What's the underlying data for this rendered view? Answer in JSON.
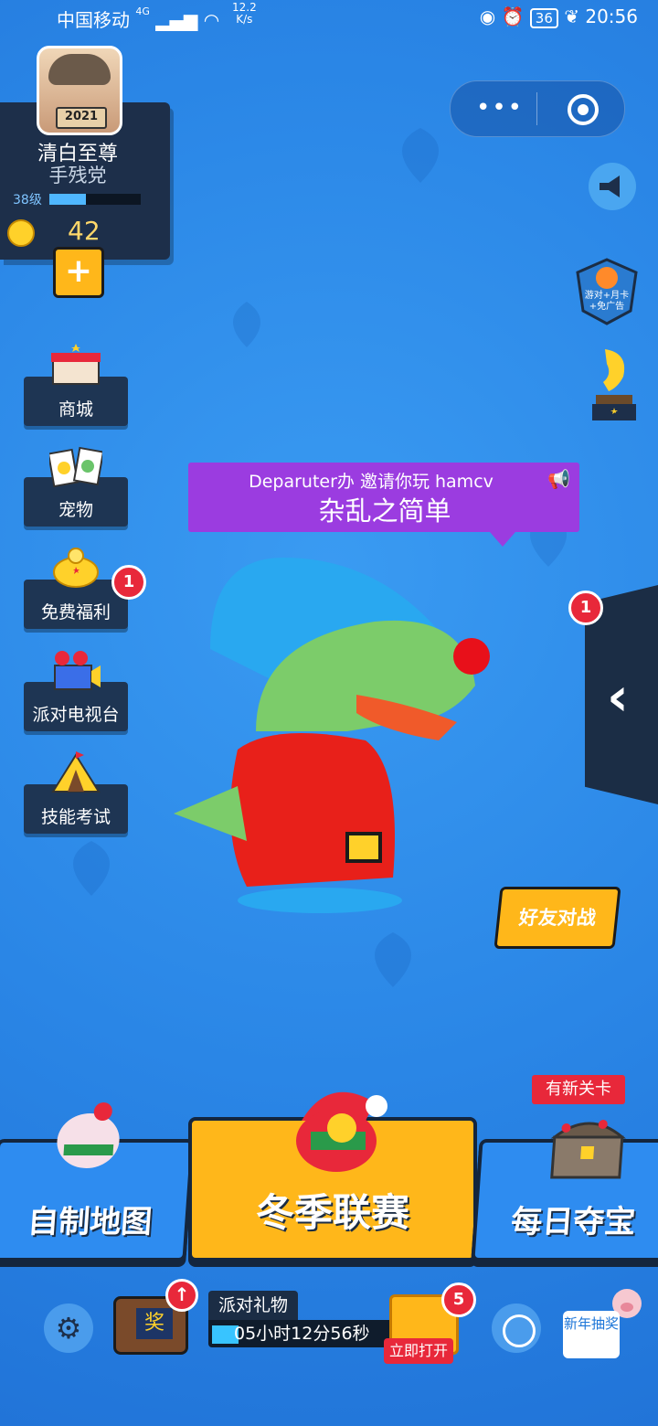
{
  "status_bar": {
    "carrier": "中国移动",
    "network": "4G",
    "speed_value": "12.2",
    "speed_unit": "K/s",
    "battery": "36",
    "time": "20:56"
  },
  "profile": {
    "avatar_tag": "2021",
    "name": "清白至尊",
    "title": "手残党",
    "level": "38级",
    "level_progress": 0.4,
    "coins": "42",
    "add_icon": "plus-icon"
  },
  "sidebar": {
    "items": [
      {
        "label": "商城",
        "icon": "shop-icon"
      },
      {
        "label": "宠物",
        "icon": "pet-cards-icon"
      },
      {
        "label": "免费福利",
        "icon": "piggy-bank-icon",
        "badge": "1"
      },
      {
        "label": "派对电视台",
        "icon": "tv-camera-icon"
      },
      {
        "label": "技能考试",
        "icon": "tent-icon"
      }
    ]
  },
  "right_panel": {
    "badge_text": "游对+月卡 +免广告",
    "drawer_badge": "1"
  },
  "invite": {
    "line1": "Deparuter办 邀请你玩 hamcv",
    "line2": "杂乱之简单"
  },
  "buttons": {
    "friend_battle": "好友对战",
    "custom_map": "自制地图",
    "winter_league": "冬季联赛",
    "daily_treasure": "每日夺宝",
    "new_level_tag": "有新关卡"
  },
  "bottom": {
    "tv_label": "奖",
    "party_gift_title": "派对礼物",
    "party_gift_time": "05小时12分56秒",
    "gift_progress": 0.14,
    "chest_badge": "5",
    "open_now": "立即打开",
    "new_year_draw": "新年抽奖"
  },
  "colors": {
    "background": "#2b8ae8",
    "accent": "#ffb71a",
    "panel": "#1d2f4a",
    "badge": "#e8283a",
    "invite": "#9b3ce0"
  }
}
